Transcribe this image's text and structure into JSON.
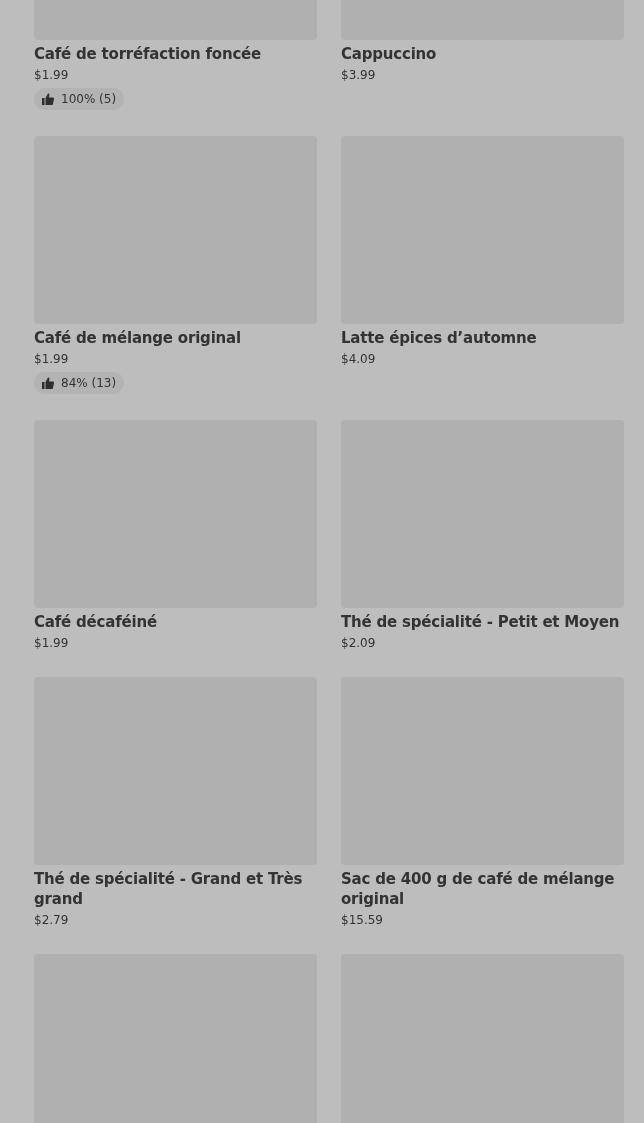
{
  "menu_items": [
    {
      "kind": "product",
      "name": "Café de torréfaction foncée",
      "price": "$1.99",
      "rating": "100% (5)"
    },
    {
      "kind": "product",
      "name": "Cappuccino",
      "price": "$3.99"
    },
    {
      "kind": "product",
      "name": "Café de mélange original",
      "price": "$1.99",
      "rating": "84% (13)"
    },
    {
      "kind": "product",
      "name": "Latte épices d’automne",
      "price": "$4.09"
    },
    {
      "kind": "product",
      "name": "Café décaféiné",
      "price": "$1.99"
    },
    {
      "kind": "product",
      "name": "Thé de spécialité - Petit et Moyen",
      "price": "$2.09"
    },
    {
      "kind": "product",
      "name": "Thé de spécialité - Grand et Très grand",
      "price": "$2.79"
    },
    {
      "kind": "product",
      "name": "Sac de 400 g de café de mélange original",
      "price": "$15.59"
    },
    {
      "kind": "image_only"
    },
    {
      "kind": "image_only"
    }
  ]
}
